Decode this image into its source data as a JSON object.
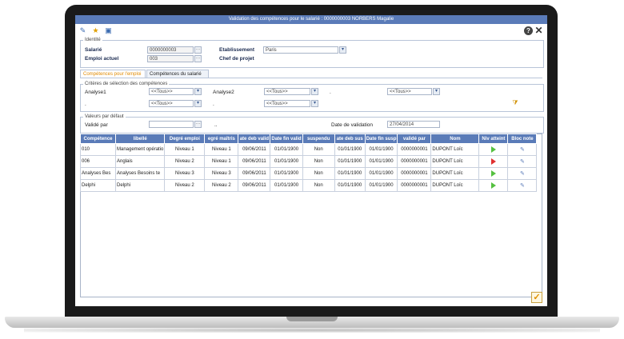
{
  "window": {
    "title": "Validation des compétences pour le salarié : 0000000003 NORBERS Magalie"
  },
  "toolbar": {
    "icons": [
      "wand-icon",
      "star-icon",
      "print-icon"
    ],
    "help": "?",
    "close": "✕"
  },
  "identite": {
    "legend": "Identité",
    "salarie_label": "Salarié",
    "salarie_value": "0000000003",
    "emploi_label": "Emploi actuel",
    "emploi_value": "003",
    "etab_label": "Etablissement",
    "etab_value": "Paris",
    "chef_label": "Chef de projet"
  },
  "tabs": [
    {
      "label": "Compétences pour l'emploi",
      "active": true
    },
    {
      "label": "Compétences du salarié",
      "active": false
    }
  ],
  "criteres": {
    "legend": "Critères de sélection des compétences",
    "analyse1_label": "Analyse1",
    "analyse1_value": "<<Tous>>",
    "analyse2_label": "Analyse2",
    "analyse2_value": "<<Tous>>",
    "analyse3_label": ".",
    "analyse3_value": "<<Tous>>",
    "row2_label1": ".",
    "row2_value1": "<<Tous>>",
    "row2_label2": ".",
    "row2_value2": "<<Tous>>"
  },
  "defaut": {
    "legend": "Valeurs par défaut",
    "valide_par_label": "Validé par",
    "valide_par_value": "",
    "dots_label": "..",
    "date_label": "Date de validation",
    "date_value": "27/04/2014"
  },
  "grid": {
    "headers": [
      "Compétence",
      "libellé",
      "Degré emploi",
      "egré maîtris",
      "ate deb valid",
      "Date fin valid",
      "suspendu",
      "ate deb sus",
      "Date fin susp",
      "validé par",
      "Nom",
      "Niv atteint",
      "Bloc note"
    ],
    "rows": [
      {
        "competence": "010",
        "libelle": "Management opératio",
        "degre_emploi": "Niveau 1",
        "degre_maitrise": "Niveau 1",
        "date_deb_valid": "09/06/2011",
        "date_fin_valid": "01/01/1900",
        "suspendu": "Non",
        "date_deb_susp": "01/01/1900",
        "date_fin_susp": "01/01/1900",
        "valide_par": "0000000001",
        "nom": "DUPONT Loïc",
        "niv_atteint": "green"
      },
      {
        "competence": "006",
        "libelle": "Anglais",
        "degre_emploi": "Niveau 2",
        "degre_maitrise": "Niveau 1",
        "date_deb_valid": "09/06/2011",
        "date_fin_valid": "01/01/1900",
        "suspendu": "Non",
        "date_deb_susp": "01/01/1900",
        "date_fin_susp": "01/01/1900",
        "valide_par": "0000000001",
        "nom": "DUPONT Loïc",
        "niv_atteint": "red"
      },
      {
        "competence": "Analyses Bes",
        "libelle": "Analyses Besoins te",
        "degre_emploi": "Niveau 3",
        "degre_maitrise": "Niveau 3",
        "date_deb_valid": "09/06/2011",
        "date_fin_valid": "01/01/1900",
        "suspendu": "Non",
        "date_deb_susp": "01/01/1900",
        "date_fin_susp": "01/01/1900",
        "valide_par": "0000000001",
        "nom": "DUPONT Loïc",
        "niv_atteint": "green"
      },
      {
        "competence": "Delphi",
        "libelle": "Delphi",
        "degre_emploi": "Niveau 2",
        "degre_maitrise": "Niveau 2",
        "date_deb_valid": "09/06/2011",
        "date_fin_valid": "01/01/1900",
        "suspendu": "Non",
        "date_deb_susp": "01/01/1900",
        "date_fin_susp": "01/01/1900",
        "valide_par": "0000000001",
        "nom": "DUPONT Loïc",
        "niv_atteint": "green"
      }
    ]
  },
  "footer": {
    "ok": "✓"
  },
  "colors": {
    "title_bar": "#5a7bb8",
    "active_tab": "#e08a00",
    "status_ok": "#55c040",
    "status_ko": "#e03030"
  }
}
